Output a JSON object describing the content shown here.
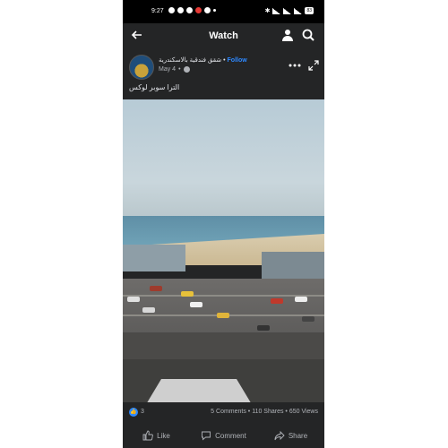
{
  "status_bar": {
    "time": "9:27",
    "battery": "83"
  },
  "header": {
    "title": "Watch"
  },
  "post": {
    "author": "شقق فندقية بالاسكندرية",
    "separator": "•",
    "follow_label": "Follow",
    "date": "May 4",
    "caption": "الترا سوبر لوكس"
  },
  "stats": {
    "reactions": "3",
    "summary": "5 Comments • 110 Shares • 650 Views"
  },
  "actions": {
    "like": "Like",
    "comment": "Comment",
    "share": "Share"
  },
  "icons": [
    "back-arrow-icon",
    "profile-icon",
    "search-icon",
    "globe-icon",
    "more-icon",
    "expand-icon",
    "thumbs-up-icon",
    "comment-icon",
    "share-icon"
  ],
  "colors": {
    "background": "#242526",
    "accent": "#2d88ff",
    "text": "#e4e6eb",
    "muted": "#b0b3b8"
  }
}
